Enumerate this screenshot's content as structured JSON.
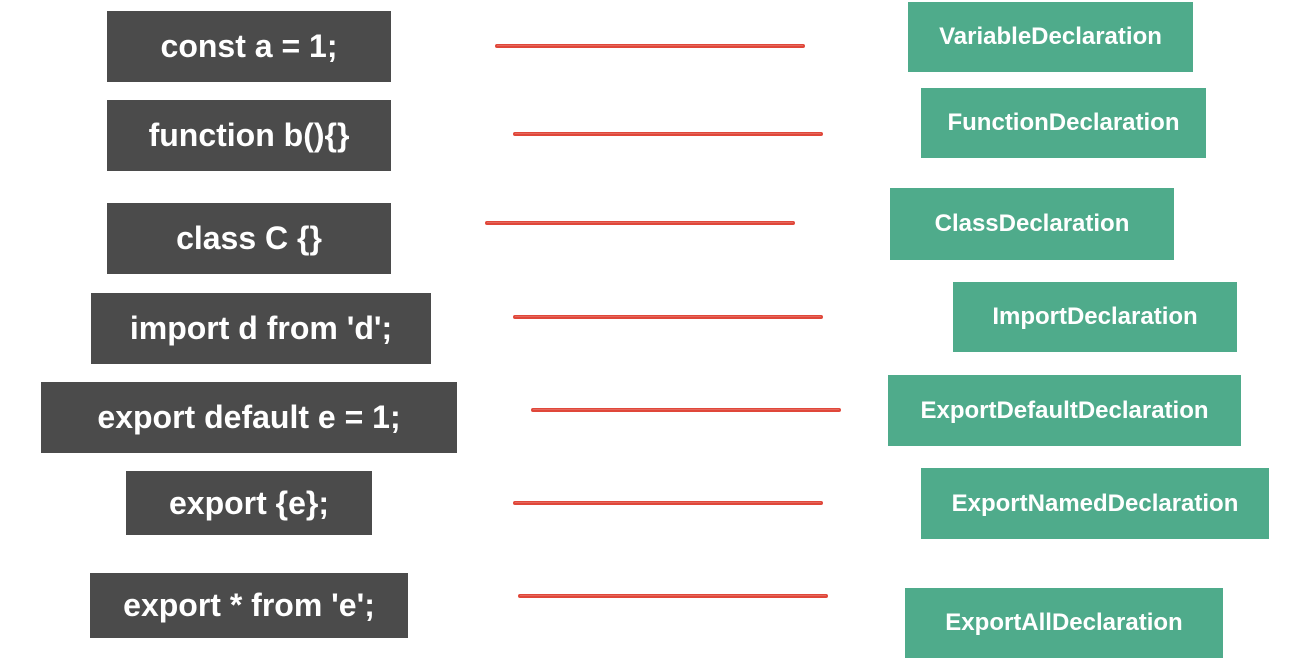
{
  "colors": {
    "code_box": "#4b4b4b",
    "node_box": "#4fab8b",
    "connector": "#e0473a",
    "background": "#ffffff"
  },
  "rows": [
    {
      "code": "const a = 1;",
      "node": "VariableDeclaration"
    },
    {
      "code": "function b(){}",
      "node": "FunctionDeclaration"
    },
    {
      "code": "class C {}",
      "node": "ClassDeclaration"
    },
    {
      "code": "import d from 'd';",
      "node": "ImportDeclaration"
    },
    {
      "code": "export default e = 1;",
      "node": "ExportDefaultDeclaration"
    },
    {
      "code": "export {e};",
      "node": "ExportNamedDeclaration"
    },
    {
      "code": "export * from 'e';",
      "node": "ExportAllDeclaration"
    }
  ]
}
